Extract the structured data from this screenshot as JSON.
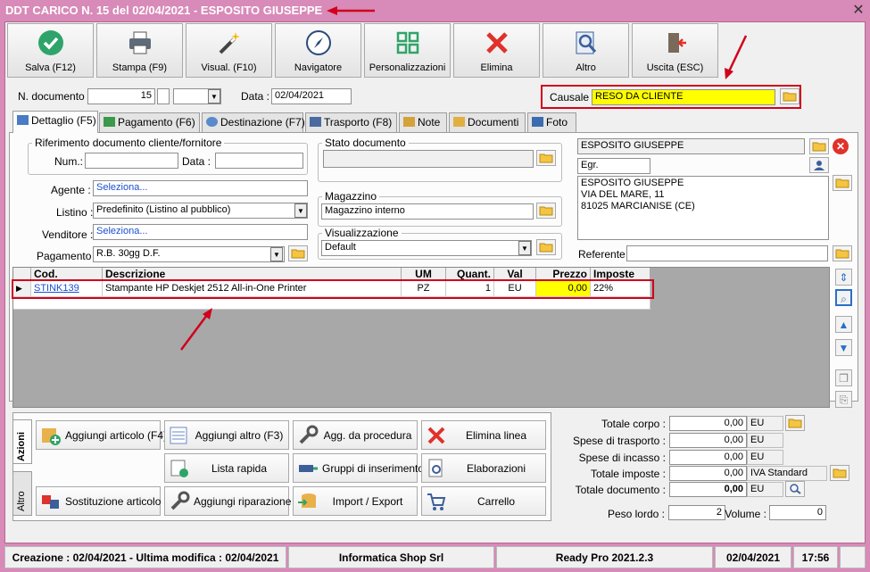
{
  "window": {
    "title": "DDT CARICO N. 15 del 02/04/2021 - ESPOSITO GIUSEPPE"
  },
  "toolbar": [
    {
      "label": "Salva (F12)",
      "icon": "check-circle-icon"
    },
    {
      "label": "Stampa (F9)",
      "icon": "printer-icon"
    },
    {
      "label": "Visual. (F10)",
      "icon": "magic-wand-icon"
    },
    {
      "label": "Navigatore",
      "icon": "compass-icon"
    },
    {
      "label": "Personalizzazioni",
      "icon": "grid-icon"
    },
    {
      "label": "Elimina",
      "icon": "x-icon"
    },
    {
      "label": "Altro",
      "icon": "magnifier-icon"
    },
    {
      "label": "Uscita (ESC)",
      "icon": "exit-door-icon"
    }
  ],
  "header": {
    "num_label": "N. documento :",
    "num_value": "15",
    "data_label": "Data :",
    "data_value": "02/04/2021",
    "causale_label": "Causale :",
    "causale_value": "RESO DA CLIENTE"
  },
  "tabs": [
    {
      "label": "Dettaglio (F5)"
    },
    {
      "label": "Pagamento (F6)"
    },
    {
      "label": "Destinazione (F7)"
    },
    {
      "label": "Trasporto (F8)"
    },
    {
      "label": "Note"
    },
    {
      "label": "Documenti"
    },
    {
      "label": "Foto"
    }
  ],
  "detail": {
    "rif_title": "Riferimento documento cliente/fornitore",
    "num_label": "Num.:",
    "data_label": "Data :",
    "agente_label": "Agente :",
    "agente_value": "Seleziona...",
    "listino_label": "Listino :",
    "listino_value": "Predefinito (Listino al pubblico)",
    "venditore_label": "Venditore :",
    "venditore_value": "Seleziona...",
    "pagamento_label": "Pagamento :",
    "pagamento_value": "R.B. 30gg D.F.",
    "stato_title": "Stato documento",
    "magazzino_title": "Magazzino",
    "magazzino_value": "Magazzino interno",
    "visual_title": "Visualizzazione",
    "visual_value": "Default",
    "cliente_name": "ESPOSITO GIUSEPPE",
    "cliente_title": "Egr.",
    "address_lines": [
      "ESPOSITO GIUSEPPE",
      "VIA DEL MARE, 11",
      "81025 MARCIANISE (CE)"
    ],
    "referente_label": "Referente"
  },
  "grid": {
    "columns": [
      "Cod.",
      "Descrizione",
      "UM",
      "Quant.",
      "Val",
      "Prezzo",
      "Imposte"
    ],
    "rows": [
      {
        "cod": "STINK139",
        "descrizione": "Stampante HP Deskjet 2512 All-in-One Printer",
        "um": "PZ",
        "quant": "1",
        "val": "EU",
        "prezzo": "0,00",
        "imposte": "22%"
      }
    ]
  },
  "actions": {
    "side_tabs": [
      "Azioni",
      "Altro"
    ],
    "buttons": [
      {
        "label": "Aggiungi articolo (F4)"
      },
      {
        "label": "Aggiungi altro (F3)"
      },
      {
        "label": "Agg. da procedura"
      },
      {
        "label": "Elimina linea"
      },
      {
        "label": "Lista rapida"
      },
      {
        "label": "Gruppi di inserimento"
      },
      {
        "label": "Elaborazioni"
      },
      {
        "label": "Sostituzione articolo"
      },
      {
        "label": "Aggiungi riparazione"
      },
      {
        "label": "Import / Export"
      },
      {
        "label": "Carrello"
      }
    ]
  },
  "totals": [
    {
      "label": "Totale corpo :",
      "value": "0,00",
      "unit": "EU"
    },
    {
      "label": "Spese di trasporto :",
      "value": "0,00",
      "unit": "EU"
    },
    {
      "label": "Spese di incasso :",
      "value": "0,00",
      "unit": "EU"
    },
    {
      "label": "Totale imposte :",
      "value": "0,00",
      "unit": "IVA Standard"
    },
    {
      "label": "Totale documento :",
      "value": "0,00",
      "unit": "EU"
    }
  ],
  "weights": {
    "peso_label": "Peso lordo :",
    "peso_value": "2",
    "volume_label": "Volume :",
    "volume_value": "0"
  },
  "status": {
    "created": "Creazione : 02/04/2021 - Ultima modifica : 02/04/2021",
    "company": "Informatica Shop Srl",
    "version": "Ready Pro 2021.2.3",
    "date": "02/04/2021",
    "time": "17:56"
  },
  "colors": {
    "highlight": "#ffff00",
    "annotation": "#d0021b",
    "window": "#d88ab8"
  }
}
